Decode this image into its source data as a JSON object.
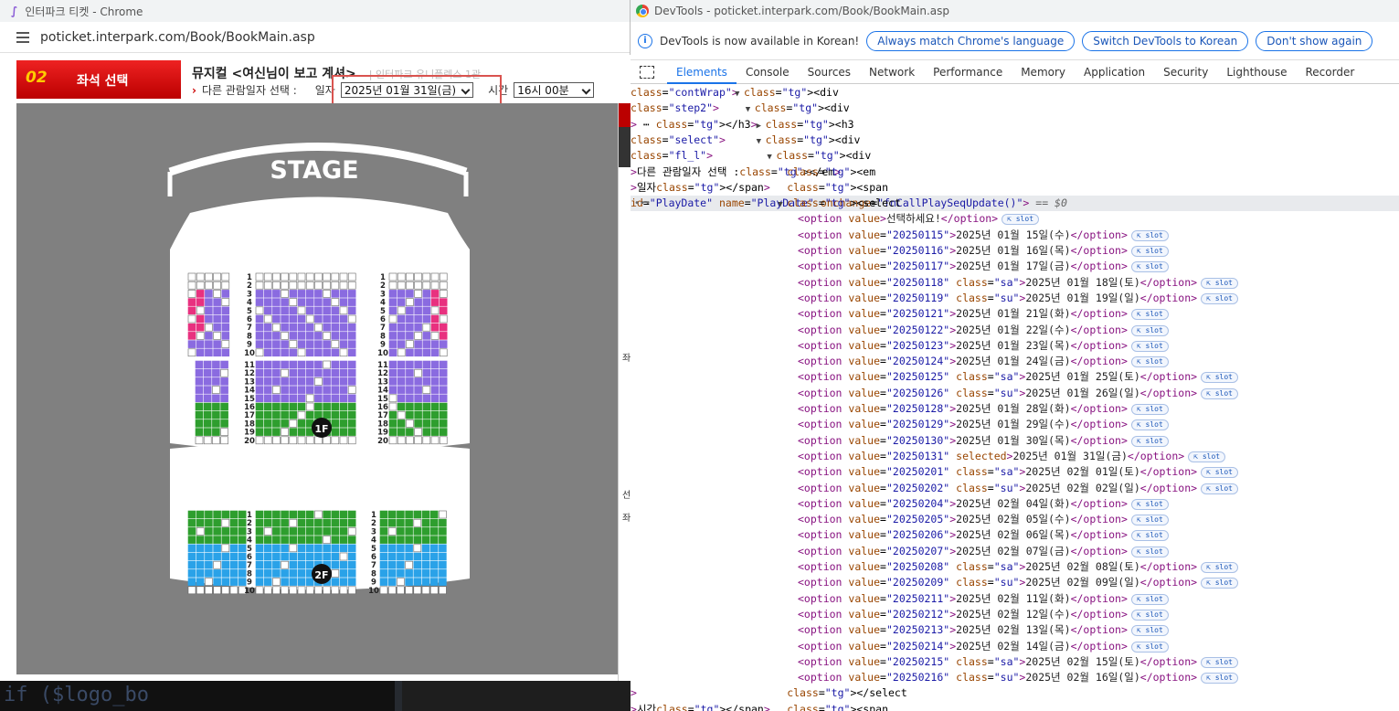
{
  "browser": {
    "window_title": "인터파크 티켓 - Chrome",
    "url": "poticket.interpark.com/Book/BookMain.asp"
  },
  "booking": {
    "step_number": "02",
    "step_label": "좌석 선택",
    "show_title": "뮤지컬 <여신님이 보고 계셔>",
    "venue": "| 인터파크 유니플렉스 1관",
    "date_prompt": "다른 관람일자 선택 :",
    "date_label": "일자",
    "selected_date": "2025년 01월 31일(금)",
    "time_label": "시간",
    "selected_time": "16시 00분",
    "side_labels": [
      "좌",
      "선",
      "좌"
    ]
  },
  "seatmap": {
    "stage_label": "STAGE",
    "floor1_label": "1F",
    "floor2_label": "2F",
    "floor1_rows": [
      "1",
      "2",
      "3",
      "4",
      "5",
      "6",
      "7",
      "8",
      "9",
      "10",
      "11",
      "12",
      "13",
      "14",
      "15",
      "16",
      "17",
      "18",
      "19",
      "20"
    ],
    "floor2_rows": [
      "1",
      "2",
      "3",
      "4",
      "5",
      "6",
      "7",
      "8",
      "9",
      "10"
    ],
    "colors": {
      "vip": "#e8317f",
      "r": "#8a6be0",
      "s": "#2e9e2e",
      "a": "#2aa2e8",
      "empty": "#ffffff",
      "bg": "#808080"
    }
  },
  "devtools": {
    "title": "DevTools - poticket.interpark.com/Book/BookMain.asp",
    "info_text": "DevTools is now available in Korean!",
    "info_buttons": [
      "Always match Chrome's language",
      "Switch DevTools to Korean",
      "Don't show again"
    ],
    "tabs": [
      "Elements",
      "Console",
      "Sources",
      "Network",
      "Performance",
      "Memory",
      "Application",
      "Security",
      "Lighthouse",
      "Recorder"
    ],
    "active_tab": "Elements",
    "badge_label": "slot",
    "tree_header": [
      {
        "indent": 0,
        "tri": "▼",
        "text": "<div class=\"contWrap\">"
      },
      {
        "indent": 1,
        "tri": "▼",
        "text": "<div class=\"step2\">"
      },
      {
        "indent": 2,
        "tri": "▶",
        "text": "<h3> ⋯ </h3>"
      },
      {
        "indent": 2,
        "tri": "▼",
        "text": "<div class=\"select\">"
      },
      {
        "indent": 3,
        "tri": "▼",
        "text": "<div class=\"fl_l\">"
      },
      {
        "indent": 4,
        "tri": "",
        "text": "<em>다른 관람일자 선택 :</em>"
      },
      {
        "indent": 4,
        "tri": "",
        "text": "<span>일자</span>"
      },
      {
        "indent": 4,
        "tri": "▼",
        "text": "<select id=\"PlayDate\" name=\"PlayDate\" onchange=\"fnCallPlaySeqUpdate()\"> == $0",
        "cur": true
      }
    ],
    "options": [
      {
        "value": "",
        "class": "",
        "selected": false,
        "text": "선택하세요!"
      },
      {
        "value": "20250115",
        "class": "",
        "selected": false,
        "text": "2025년 01월 15일(수)"
      },
      {
        "value": "20250116",
        "class": "",
        "selected": false,
        "text": "2025년 01월 16일(목)"
      },
      {
        "value": "20250117",
        "class": "",
        "selected": false,
        "text": "2025년 01월 17일(금)"
      },
      {
        "value": "20250118",
        "class": "sa",
        "selected": false,
        "text": "2025년 01월 18일(토)"
      },
      {
        "value": "20250119",
        "class": "su",
        "selected": false,
        "text": "2025년 01월 19일(일)"
      },
      {
        "value": "20250121",
        "class": "",
        "selected": false,
        "text": "2025년 01월 21일(화)"
      },
      {
        "value": "20250122",
        "class": "",
        "selected": false,
        "text": "2025년 01월 22일(수)"
      },
      {
        "value": "20250123",
        "class": "",
        "selected": false,
        "text": "2025년 01월 23일(목)"
      },
      {
        "value": "20250124",
        "class": "",
        "selected": false,
        "text": "2025년 01월 24일(금)"
      },
      {
        "value": "20250125",
        "class": "sa",
        "selected": false,
        "text": "2025년 01월 25일(토)"
      },
      {
        "value": "20250126",
        "class": "su",
        "selected": false,
        "text": "2025년 01월 26일(일)"
      },
      {
        "value": "20250128",
        "class": "",
        "selected": false,
        "text": "2025년 01월 28일(화)"
      },
      {
        "value": "20250129",
        "class": "",
        "selected": false,
        "text": "2025년 01월 29일(수)"
      },
      {
        "value": "20250130",
        "class": "",
        "selected": false,
        "text": "2025년 01월 30일(목)"
      },
      {
        "value": "20250131",
        "class": "",
        "selected": true,
        "text": "2025년 01월 31일(금)"
      },
      {
        "value": "20250201",
        "class": "sa",
        "selected": false,
        "text": "2025년 02월 01일(토)"
      },
      {
        "value": "20250202",
        "class": "su",
        "selected": false,
        "text": "2025년 02월 02일(일)"
      },
      {
        "value": "20250204",
        "class": "",
        "selected": false,
        "text": "2025년 02월 04일(화)"
      },
      {
        "value": "20250205",
        "class": "",
        "selected": false,
        "text": "2025년 02월 05일(수)"
      },
      {
        "value": "20250206",
        "class": "",
        "selected": false,
        "text": "2025년 02월 06일(목)"
      },
      {
        "value": "20250207",
        "class": "",
        "selected": false,
        "text": "2025년 02월 07일(금)"
      },
      {
        "value": "20250208",
        "class": "sa",
        "selected": false,
        "text": "2025년 02월 08일(토)"
      },
      {
        "value": "20250209",
        "class": "su",
        "selected": false,
        "text": "2025년 02월 09일(일)"
      },
      {
        "value": "20250211",
        "class": "",
        "selected": false,
        "text": "2025년 02월 11일(화)"
      },
      {
        "value": "20250212",
        "class": "",
        "selected": false,
        "text": "2025년 02월 12일(수)"
      },
      {
        "value": "20250213",
        "class": "",
        "selected": false,
        "text": "2025년 02월 13일(목)"
      },
      {
        "value": "20250214",
        "class": "",
        "selected": false,
        "text": "2025년 02월 14일(금)"
      },
      {
        "value": "20250215",
        "class": "sa",
        "selected": false,
        "text": "2025년 02월 15일(토)"
      },
      {
        "value": "20250216",
        "class": "su",
        "selected": false,
        "text": "2025년 02월 16일(일)"
      }
    ],
    "tree_footer": [
      {
        "indent": 4,
        "tri": "",
        "text": "</select>"
      },
      {
        "indent": 4,
        "tri": "",
        "text": "<span>시간</span>"
      }
    ]
  },
  "background": {
    "code_text": "if ($logo_bo"
  }
}
